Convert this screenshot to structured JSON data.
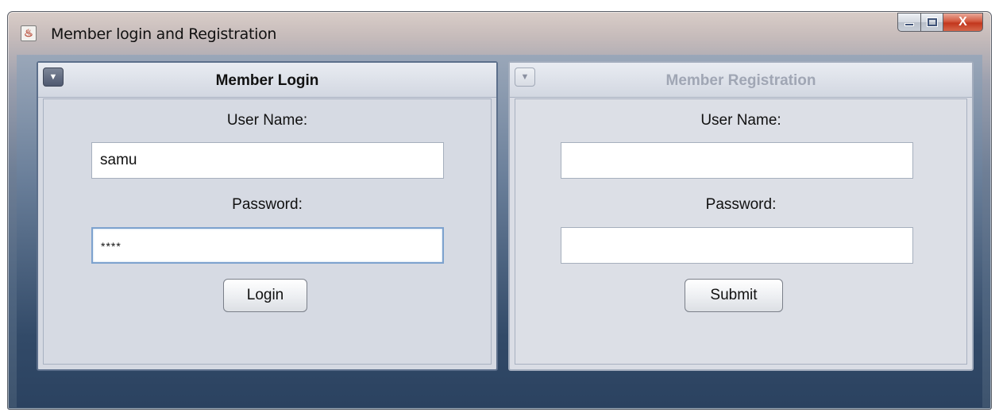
{
  "window": {
    "title": "Member login and Registration",
    "icon": "java-cup-icon",
    "controls": {
      "minimize": "minimize-icon",
      "maximize": "maximize-icon",
      "close": "X"
    }
  },
  "login_panel": {
    "title": "Member Login",
    "collapse_glyph": "▼",
    "username_label": "User Name:",
    "username_value": "samu",
    "password_label": "Password:",
    "password_value": "****",
    "button_label": "Login"
  },
  "registration_panel": {
    "title": "Member Registration",
    "collapse_glyph": "▼",
    "username_label": "User Name:",
    "username_value": "",
    "password_label": "Password:",
    "password_value": "",
    "button_label": "Submit"
  },
  "colors": {
    "accent_focus": "#7da2ce",
    "close_button": "#c2371d"
  }
}
